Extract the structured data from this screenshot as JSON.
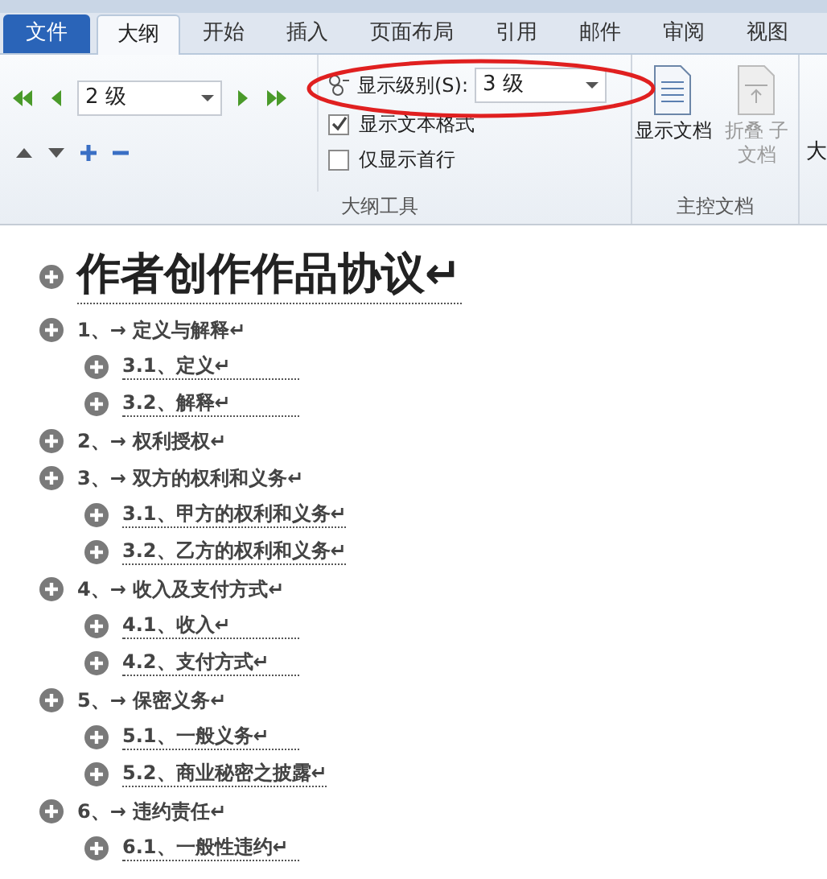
{
  "tabs": [
    {
      "label": "文件",
      "kind": "file",
      "selected": false
    },
    {
      "label": "大纲",
      "kind": "tab",
      "selected": true
    },
    {
      "label": "开始",
      "kind": "tab",
      "selected": false
    },
    {
      "label": "插入",
      "kind": "tab",
      "selected": false
    },
    {
      "label": "页面布局",
      "kind": "tab",
      "selected": false
    },
    {
      "label": "引用",
      "kind": "tab",
      "selected": false
    },
    {
      "label": "邮件",
      "kind": "tab",
      "selected": false
    },
    {
      "label": "审阅",
      "kind": "tab",
      "selected": false
    },
    {
      "label": "视图",
      "kind": "tab",
      "selected": false
    }
  ],
  "outline_tools": {
    "level_value": "2 级",
    "show_level_label": "显示级别(S):",
    "show_level_value": "3 级",
    "options": [
      {
        "label": "显示文本格式",
        "checked": true
      },
      {
        "label": "仅显示首行",
        "checked": false
      }
    ],
    "group_label": "大纲工具"
  },
  "master_document": {
    "buttons": [
      {
        "label": "显示文档",
        "disabled": false
      },
      {
        "label": "折叠 子文档",
        "disabled": true
      }
    ],
    "group_label": "主控文档"
  },
  "next_group_cut": "大",
  "document": {
    "title": "作者创作作品协议↵",
    "outline": [
      {
        "text": "1、→ 定义与解释↵",
        "children": [
          {
            "text": "3.1、定义↵"
          },
          {
            "text": "3.2、解释↵"
          }
        ]
      },
      {
        "text": "2、→ 权利授权↵"
      },
      {
        "text": "3、→ 双方的权利和义务↵",
        "children": [
          {
            "text": "3.1、甲方的权利和义务↵"
          },
          {
            "text": "3.2、乙方的权利和义务↵"
          }
        ]
      },
      {
        "text": "4、→ 收入及支付方式↵",
        "children": [
          {
            "text": "4.1、收入↵"
          },
          {
            "text": "4.2、支付方式↵"
          }
        ]
      },
      {
        "text": "5、→ 保密义务↵",
        "children": [
          {
            "text": "5.1、一般义务↵"
          },
          {
            "text": "5.2、商业秘密之披露↵"
          }
        ]
      },
      {
        "text": "6、→ 违约责任↵",
        "children": [
          {
            "text": "6.1、一般性违约↵"
          }
        ]
      }
    ]
  }
}
